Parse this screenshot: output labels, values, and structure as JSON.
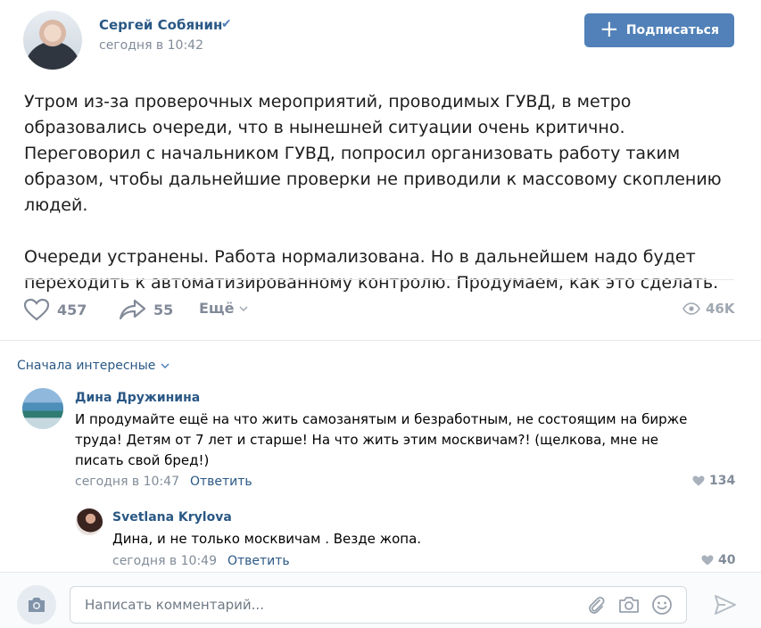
{
  "post": {
    "author": "Сергей Собянин",
    "time": "сегодня в 10:42",
    "subscribe_label": "Подписаться",
    "paragraphs": [
      "Утром из-за проверочных мероприятий, проводимых ГУВД, в метро образовались очереди, что в нынешней ситуации очень критично. Переговорил с начальником ГУВД, попросил организовать работу таким образом, чтобы дальнейшие проверки не приводили к массовому скоплению людей.",
      "Очереди устранены. Работа нормализована. Но в дальнейшем надо будет переходить к автоматизированному контролю. Продумаем, как это сделать."
    ],
    "likes": "457",
    "shares": "55",
    "more_label": "Ещё",
    "views": "46K"
  },
  "comments": {
    "sort_label": "Сначала интересные",
    "items": [
      {
        "author": "Дина Дружинина",
        "text": "И продумайте ещё на что жить самозанятым и безработным, не состоящим на бирже труда! Детям от 7 лет и старше! На что жить этим москвичам?! (щелкова, мне не писать свой бред!)",
        "time": "сегодня в 10:47",
        "reply_label": "Ответить",
        "likes": "134"
      },
      {
        "author": "Svetlana Krylova",
        "text": "Дина, и не только москвичам . Везде жопа.",
        "time": "сегодня в 10:49",
        "reply_label": "Ответить",
        "likes": "40"
      }
    ]
  },
  "composer": {
    "placeholder": "Написать комментарий..."
  },
  "colors": {
    "accent": "#5181b8",
    "link": "#2a5885",
    "muted": "#818c99"
  },
  "icons": [
    "verified-icon",
    "apple-icon",
    "plus-icon",
    "heart-icon",
    "share-icon",
    "chevron-down-icon",
    "eye-icon",
    "camera-icon",
    "paperclip-icon",
    "smile-icon",
    "send-icon"
  ]
}
